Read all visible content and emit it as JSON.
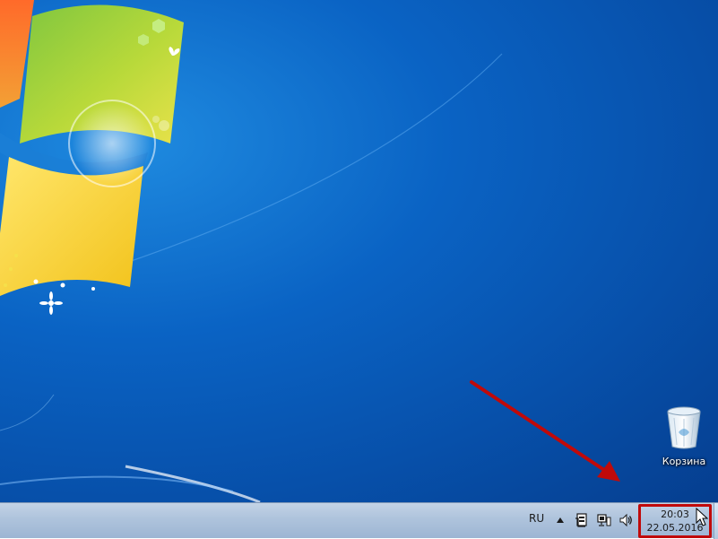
{
  "desktop": {
    "icons": [
      {
        "label": "Корзина",
        "icon": "recycle-bin-icon"
      }
    ]
  },
  "annotation": {
    "arrow_color": "#c00a0a",
    "highlight_color": "#c00a0a"
  },
  "taskbar": {
    "language": "RU",
    "tray_icons": [
      "show-hidden-icons-icon",
      "action-center-icon",
      "network-icon",
      "volume-icon"
    ],
    "clock": {
      "time": "20:03",
      "date": "22.05.2016"
    }
  }
}
